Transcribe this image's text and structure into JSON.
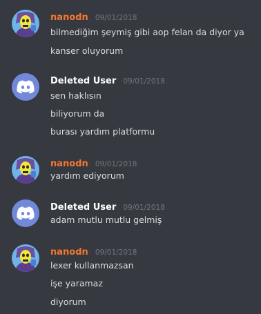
{
  "colors": {
    "background": "#36393f",
    "nanodn_name": "#f57731",
    "deleted_user_name": "#ffffff",
    "timestamp": "#72767d",
    "message_text": "#dcddde",
    "discord_blurple": "#7289da"
  },
  "messages": [
    {
      "author": "nanodn",
      "timestamp": "09/01/2018",
      "avatar_icon": "skeletor-avatar-icon",
      "lines": [
        "bilmediğim şeymiş gibi aop felan da diyor ya",
        "kanser oluyorum"
      ]
    },
    {
      "author": "Deleted User",
      "timestamp": "09/01/2018",
      "avatar_icon": "discord-logo-avatar-icon",
      "lines": [
        "sen haklısın",
        "biliyorum da",
        "burası yardım platformu"
      ]
    },
    {
      "author": "nanodn",
      "timestamp": "09/01/2018",
      "avatar_icon": "skeletor-avatar-icon",
      "lines": [
        "yardım ediyorum"
      ]
    },
    {
      "author": "Deleted User",
      "timestamp": "09/01/2018",
      "avatar_icon": "discord-logo-avatar-icon",
      "lines": [
        "adam mutlu mutlu gelmiş"
      ]
    },
    {
      "author": "nanodn",
      "timestamp": "09/01/2018",
      "avatar_icon": "skeletor-avatar-icon",
      "lines": [
        "lexer kullanmazsan",
        "işe yaramaz",
        "diyorum"
      ]
    }
  ]
}
